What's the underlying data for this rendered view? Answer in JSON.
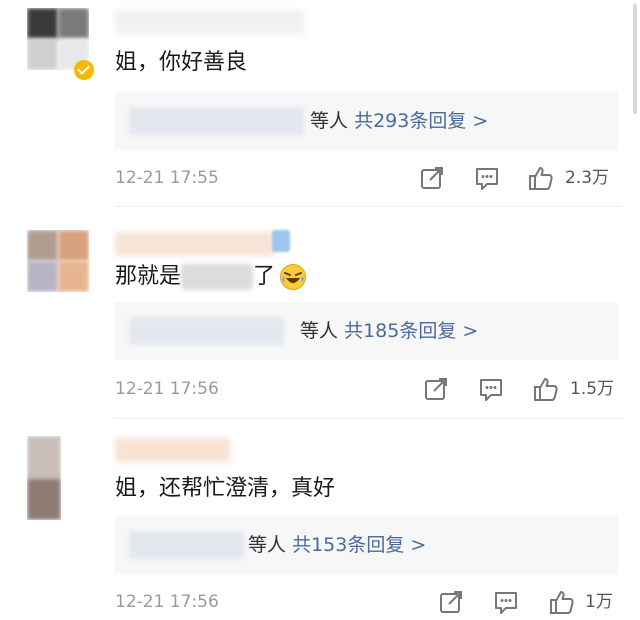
{
  "comments": [
    {
      "text_prefix": "姐，你好善良",
      "text_suffix": "",
      "reply_names_suffix": "等人",
      "reply_count_text": "共293条回复 >",
      "timestamp": "12-21 17:55",
      "like_count": "2.3万"
    },
    {
      "text_prefix": "那就是",
      "text_suffix": "了",
      "reply_names_suffix": "等人",
      "reply_count_text": "共185条回复 >",
      "timestamp": "12-21 17:56",
      "like_count": "1.5万"
    },
    {
      "text_prefix": "姐，还帮忙澄清，真好",
      "text_suffix": "",
      "reply_names_suffix": "等人",
      "reply_count_text": "共153条回复 >",
      "timestamp": "12-21 17:56",
      "like_count": "1万"
    }
  ],
  "icons": {
    "share": "share-icon",
    "comment": "comment-icon",
    "like": "thumbs-up-icon",
    "emoji": "laughing-tears-emoji"
  },
  "colors": {
    "reply_link": "#4a6b99",
    "timestamp": "#9a9a9a",
    "reply_box_bg": "#f7f7f7",
    "verified_badge": "#f5b800"
  }
}
